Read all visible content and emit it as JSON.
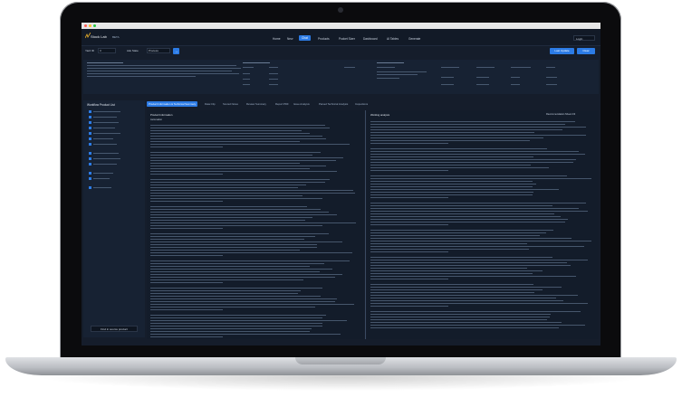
{
  "app": {
    "logo_text": "Stock Lab",
    "logo_suffix": "BETA",
    "nav": [
      "Home",
      "New",
      "Chat",
      "Products",
      "Pocket Sizer",
      "Dashboard",
      "AI Tables",
      "Generate"
    ],
    "active_nav": "Chat",
    "login_label": "Login"
  },
  "filter": {
    "label1": "Yard ID",
    "value1": "3",
    "label2": "Ask State",
    "value2": "Process",
    "go_label": "→",
    "btn1": "Last Update",
    "btn2": "Clear"
  },
  "colors": {
    "accent": "#2c7be5",
    "bg": "#151d2b",
    "panel": "#172233"
  },
  "sidebar": {
    "title": "Workflow Product List",
    "button": "Find in source product"
  },
  "tabs": [
    "Product Information & Technical Summary",
    "Data Clip",
    "Scored Notes",
    "Review Summary",
    "Report PDF",
    "Issue Analysis",
    "Parsed Technical Analysis",
    "Inspections"
  ],
  "left_pane": {
    "title": "Product Information",
    "sub": "Automation"
  },
  "right_pane": {
    "title": "Working analysis",
    "meta": "Recommendation Sheet 2/3"
  }
}
